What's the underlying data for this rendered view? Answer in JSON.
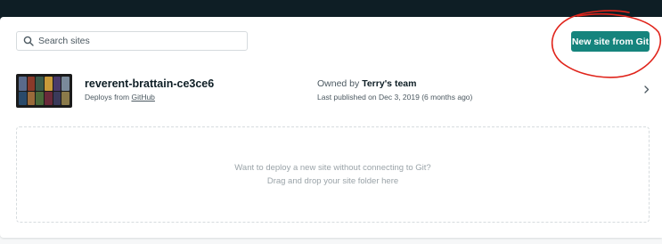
{
  "search": {
    "placeholder": "Search sites"
  },
  "actions": {
    "new_site_label": "New site from Git"
  },
  "site": {
    "name": "reverent-brattain-ce3ce6",
    "deploys_prefix": "Deploys from",
    "deploys_source": "GitHub",
    "owner_prefix": "Owned by",
    "owner_team": "Terry's team",
    "published": "Last published on Dec 3, 2019 (6 months ago)"
  },
  "dropzone": {
    "line1": "Want to deploy a new site without connecting to Git?",
    "line2": "Drag and drop your site folder here"
  },
  "colors": {
    "topbar": "#0e1e25",
    "accent": "#15847d",
    "annotation": "#e0241b"
  },
  "icons": {
    "search": "search-icon",
    "chevron": "chevron-right-icon"
  }
}
